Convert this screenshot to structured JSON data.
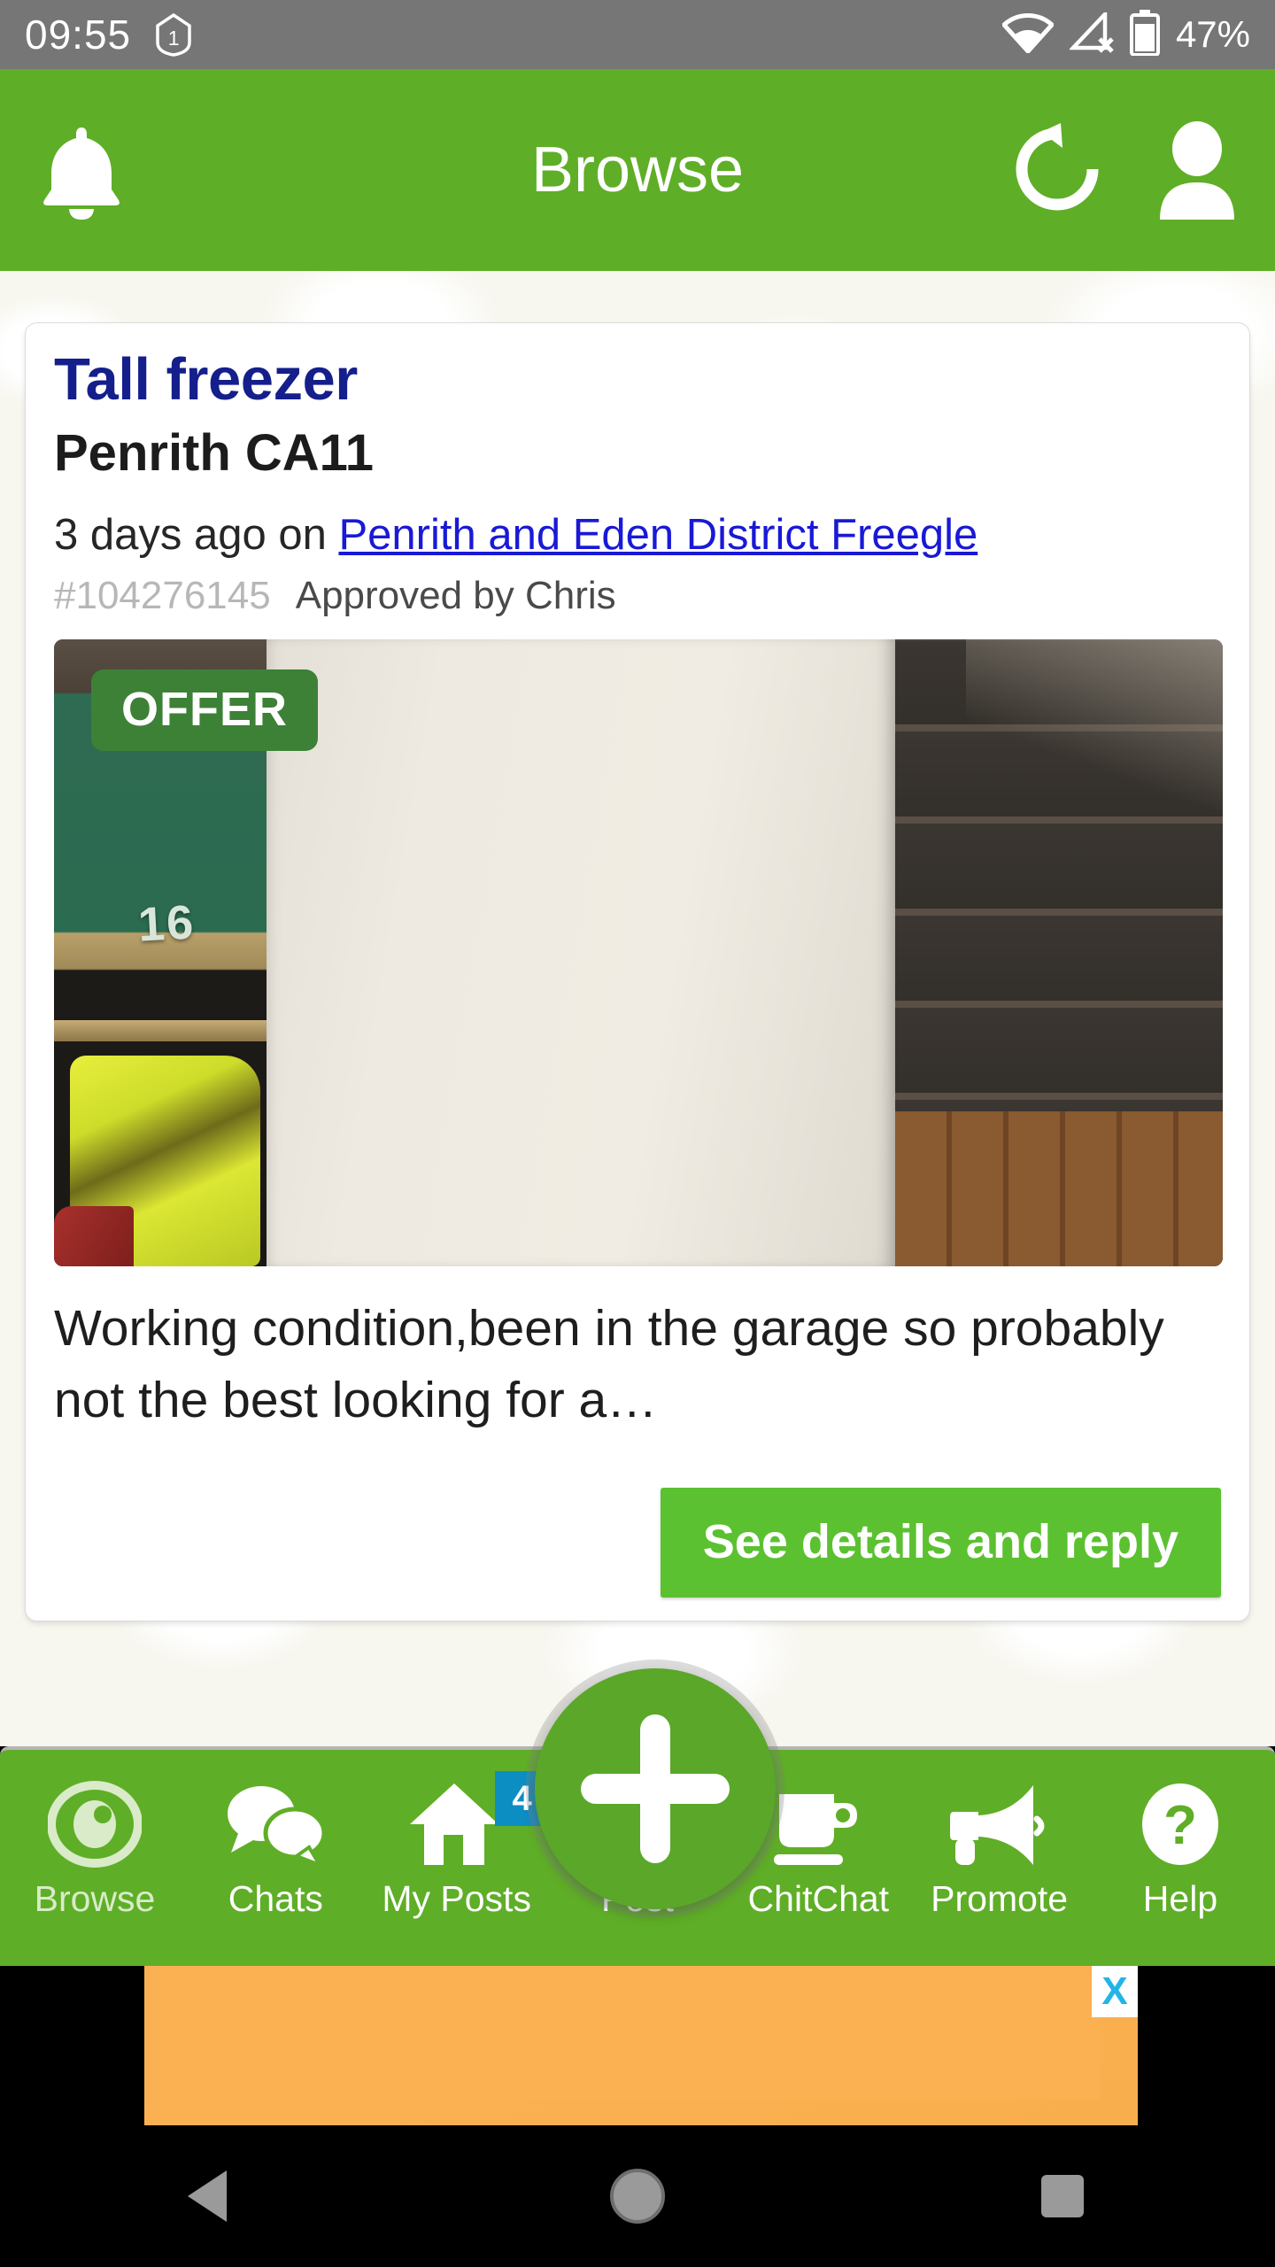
{
  "status_bar": {
    "time": "09:55",
    "shield_badge": "1",
    "wifi_icon": "wifi-icon",
    "cellular_icon": "cellular-no-signal-icon",
    "battery_icon": "battery-icon",
    "battery_percent": "47%"
  },
  "app_bar": {
    "title": "Browse",
    "bell_icon": "bell-icon",
    "refresh_icon": "refresh-icon",
    "profile_icon": "person-icon"
  },
  "post": {
    "title": "Tall freezer",
    "location": "Penrith CA11",
    "meta_prefix": "3 days ago on ",
    "group_link": "Penrith and Eden District Freegle",
    "post_id": "#104276145",
    "approved_by": "Approved by Chris",
    "type_badge": "OFFER",
    "photo_bin_number": "16",
    "description": "Working condition,been in the garage so probably not the best looking for a…",
    "cta_label": "See details and reply"
  },
  "bottom_nav": {
    "items": [
      {
        "label": "Browse",
        "icon": "eye-icon",
        "badge": "",
        "active": true
      },
      {
        "label": "Chats",
        "icon": "chat-bubbles-icon",
        "badge": "",
        "active": false
      },
      {
        "label": "My Posts",
        "icon": "house-icon",
        "badge": "4",
        "active": false
      },
      {
        "label": "Post",
        "icon": "plus-icon",
        "badge": "",
        "active": false
      },
      {
        "label": "ChitChat",
        "icon": "coffee-mug-icon",
        "badge": "",
        "active": false
      },
      {
        "label": "Promote",
        "icon": "megaphone-icon",
        "badge": "",
        "active": false
      },
      {
        "label": "Help",
        "icon": "question-mark-icon",
        "badge": "",
        "active": false
      }
    ]
  },
  "ad": {
    "close_label": "X"
  },
  "android_nav": {
    "back_icon": "back-triangle-icon",
    "home_icon": "home-circle-icon",
    "recents_icon": "recents-square-icon"
  },
  "colors": {
    "brand_green": "#5FAE27",
    "cta_green": "#5BC130",
    "offer_green": "#3D8136",
    "badge_blue": "#0D8EC3",
    "link_blue": "#1919D6",
    "title_blue": "#141F8C",
    "status_grey": "#767676",
    "ad_orange": "#FBB052"
  }
}
